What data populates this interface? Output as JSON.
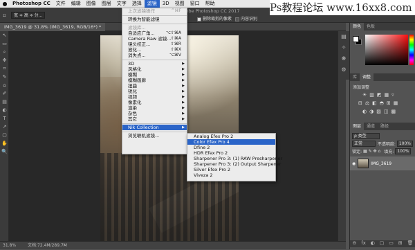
{
  "menubar": {
    "apple_icon": "",
    "items": [
      "Photoshop CC",
      "文件",
      "编辑",
      "图像",
      "图层",
      "文字",
      "选择",
      "滤镜",
      "3D",
      "视图",
      "窗口",
      "帮助"
    ],
    "active_index": 7
  },
  "watermark": "Ps教程论坛 www.16xx8.com",
  "window_title": "Adobe Photoshop CC 2017",
  "options_bar": {
    "tool_preset": "宽 ≑ 高 ≑ 分...",
    "delete_cropped_label": "删除裁剪的像素",
    "content_aware_label": "内容识别"
  },
  "document_tab": "IMG_3619 @ 31.8% (IMG_3619, RGB/16*) *",
  "tools": [
    "↖",
    "▭",
    "⌕",
    "✥",
    "⌗",
    "✎",
    "⌂",
    "✐",
    "▤",
    "◐",
    "T",
    "↗",
    "▢",
    "✋",
    "🔍"
  ],
  "status_bar": {
    "zoom": "31.8%",
    "doc_info": "文档:72.4M/289.7M"
  },
  "filter_menu": {
    "items": [
      {
        "label": "上次滤镜操作",
        "shortcut": "^⌘F",
        "disabled": true,
        "submenu": false
      },
      {
        "separator": true
      },
      {
        "label": "转换为智能滤镜",
        "shortcut": "",
        "disabled": false,
        "submenu": false
      },
      {
        "separator": true
      },
      {
        "label": "滤镜库...",
        "shortcut": "",
        "disabled": true,
        "submenu": false
      },
      {
        "label": "自适应广角...",
        "shortcut": "⌥⇧⌘A",
        "disabled": false,
        "submenu": false
      },
      {
        "label": "Camera Raw 滤镜...",
        "shortcut": "⇧⌘A",
        "disabled": false,
        "submenu": false
      },
      {
        "label": "镜头校正...",
        "shortcut": "⇧⌘R",
        "disabled": false,
        "submenu": false
      },
      {
        "label": "液化...",
        "shortcut": "⇧⌘X",
        "disabled": false,
        "submenu": false
      },
      {
        "label": "消失点...",
        "shortcut": "⌥⌘V",
        "disabled": false,
        "submenu": false
      },
      {
        "separator": true
      },
      {
        "label": "3D",
        "shortcut": "",
        "disabled": false,
        "submenu": true
      },
      {
        "label": "风格化",
        "shortcut": "",
        "disabled": false,
        "submenu": true
      },
      {
        "label": "模糊",
        "shortcut": "",
        "disabled": false,
        "submenu": true
      },
      {
        "label": "模糊画廊",
        "shortcut": "",
        "disabled": false,
        "submenu": true
      },
      {
        "label": "扭曲",
        "shortcut": "",
        "disabled": false,
        "submenu": true
      },
      {
        "label": "锐化",
        "shortcut": "",
        "disabled": false,
        "submenu": true
      },
      {
        "label": "视频",
        "shortcut": "",
        "disabled": false,
        "submenu": true
      },
      {
        "label": "像素化",
        "shortcut": "",
        "disabled": false,
        "submenu": true
      },
      {
        "label": "渲染",
        "shortcut": "",
        "disabled": false,
        "submenu": true
      },
      {
        "label": "杂色",
        "shortcut": "",
        "disabled": false,
        "submenu": true
      },
      {
        "label": "其它",
        "shortcut": "",
        "disabled": false,
        "submenu": true
      },
      {
        "separator": true
      },
      {
        "label": "Nik Collection",
        "shortcut": "",
        "disabled": false,
        "submenu": true,
        "highlighted": true
      },
      {
        "separator": true
      },
      {
        "label": "浏览联机滤镜...",
        "shortcut": "",
        "disabled": false,
        "submenu": false
      }
    ]
  },
  "nik_submenu": {
    "items": [
      {
        "label": "Analog Efex Pro 2",
        "highlighted": false
      },
      {
        "label": "Color Efex Pro 4",
        "highlighted": true
      },
      {
        "label": "Dfine 2",
        "highlighted": false
      },
      {
        "label": "HDR Efex Pro 2",
        "highlighted": false
      },
      {
        "label": "Sharpener Pro 3: (1) RAW Presharpener",
        "highlighted": false
      },
      {
        "label": "Sharpener Pro 3: (2) Output Sharpener",
        "highlighted": false
      },
      {
        "label": "Silver Efex Pro 2",
        "highlighted": false
      },
      {
        "label": "Viveza 2",
        "highlighted": false
      }
    ]
  },
  "right_icons": [
    "▤",
    "✧",
    "❋",
    "⚙"
  ],
  "color_panel": {
    "tabs": [
      "颜色",
      "色板"
    ],
    "active": 0
  },
  "adjust_panel": {
    "tabs": [
      "库",
      "调整"
    ],
    "active": 1,
    "label": "添加调整",
    "row1": [
      "☀",
      "▥",
      "◩",
      "▦",
      "▿"
    ],
    "row2": [
      "⊟",
      "⚖",
      "◧",
      "◓",
      "⊞",
      "▦"
    ],
    "row3": [
      "◐",
      "◑",
      "▨",
      "◫",
      "▩"
    ]
  },
  "layers_panel": {
    "tabs": [
      "图层",
      "通道",
      "路径"
    ],
    "active": 0,
    "kind_label": "ρ 类型",
    "blend_mode": "正常",
    "opacity_label": "不透明度:",
    "opacity_value": "100%",
    "lock_label": "锁定:",
    "fill_label": "填充:",
    "fill_value": "100%",
    "layer_name": "IMG_3619",
    "footer_icons": [
      "⊖",
      "fx",
      "◐",
      "▢",
      "▭",
      "⊞",
      "🗑"
    ]
  }
}
